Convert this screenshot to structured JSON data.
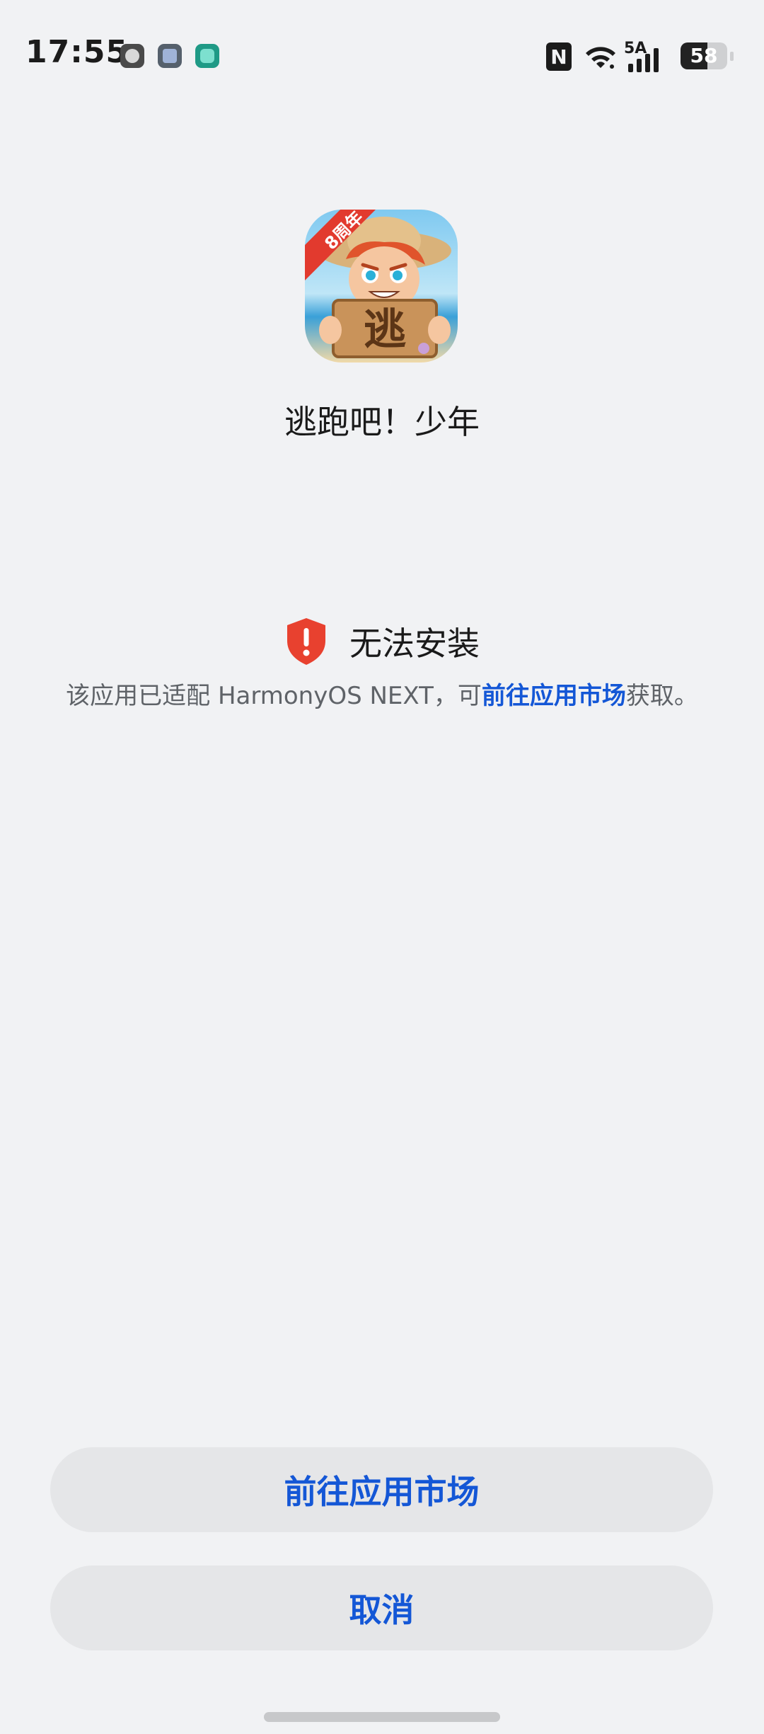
{
  "status_bar": {
    "time": "17:55",
    "notification_icons": [
      "contact-avatar-icon",
      "chat-app-icon",
      "tap-app-icon"
    ],
    "nfc_label": "N",
    "signal_label": "5A",
    "battery_level": "58"
  },
  "app": {
    "name": "逃跑吧！少年",
    "icon_badge": "8周年",
    "icon_sign_text": "逃"
  },
  "warning": {
    "title": "无法安装",
    "desc_prefix": "该应用已适配 HarmonyOS NEXT，可",
    "desc_link": "前往应用市场",
    "desc_suffix": "获取。",
    "icon_color": "#e8412f"
  },
  "buttons": {
    "market_label": "前往应用市场",
    "cancel_label": "取消"
  },
  "colors": {
    "accent": "#1457d6",
    "background": "#f1f2f4",
    "button_bg": "#e5e6e8"
  }
}
